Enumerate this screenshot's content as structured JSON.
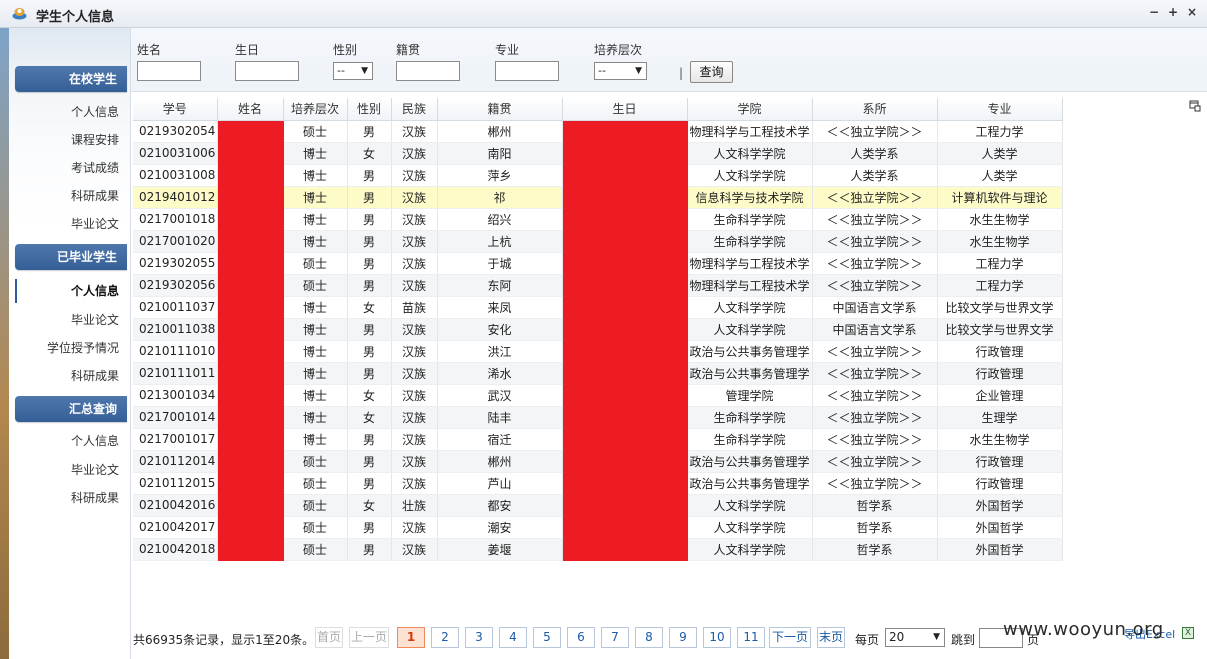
{
  "window": {
    "title": "学生个人信息",
    "controls": [
      "−",
      "+",
      "×"
    ]
  },
  "sidebar": {
    "sections": [
      {
        "header": "在校学生",
        "items": [
          {
            "label": "个人信息"
          },
          {
            "label": "课程安排"
          },
          {
            "label": "考试成绩"
          },
          {
            "label": "科研成果"
          },
          {
            "label": "毕业论文"
          }
        ]
      },
      {
        "header": "已毕业学生",
        "items": [
          {
            "label": "个人信息",
            "active": true
          },
          {
            "label": "毕业论文"
          },
          {
            "label": "学位授予情况"
          },
          {
            "label": "科研成果"
          }
        ]
      },
      {
        "header": "汇总查询",
        "items": [
          {
            "label": "个人信息"
          },
          {
            "label": "毕业论文"
          },
          {
            "label": "科研成果"
          }
        ]
      }
    ]
  },
  "search": {
    "name_label": "姓名",
    "birthday_label": "生日",
    "gender_label": "性别",
    "gender_value": "--",
    "hometown_label": "籍贯",
    "major_label": "专业",
    "level_label": "培养层次",
    "level_value": "--",
    "separator": "|",
    "query_button": "查询"
  },
  "table": {
    "columns": [
      "学号",
      "姓名",
      "培养层次",
      "性别",
      "民族",
      "籍贯",
      "生日",
      "学院",
      "系所",
      "专业"
    ],
    "rows": [
      [
        "0219302054",
        "",
        "硕士",
        "男",
        "汉族",
        "郴州",
        "",
        "物理科学与工程技术学",
        "＜＜独立学院＞＞",
        "工程力学"
      ],
      [
        "0210031006",
        "",
        "博士",
        "女",
        "汉族",
        "南阳",
        "",
        "人文科学学院",
        "人类学系",
        "人类学"
      ],
      [
        "0210031008",
        "",
        "博士",
        "男",
        "汉族",
        "萍乡",
        "",
        "人文科学学院",
        "人类学系",
        "人类学"
      ],
      [
        "0219401012",
        "",
        "博士",
        "男",
        "汉族",
        "祁",
        "",
        "信息科学与技术学院",
        "＜＜独立学院＞＞",
        "计算机软件与理论"
      ],
      [
        "0217001018",
        "",
        "博士",
        "男",
        "汉族",
        "绍兴",
        "",
        "生命科学学院",
        "＜＜独立学院＞＞",
        "水生生物学"
      ],
      [
        "0217001020",
        "",
        "博士",
        "男",
        "汉族",
        "上杭",
        "",
        "生命科学学院",
        "＜＜独立学院＞＞",
        "水生生物学"
      ],
      [
        "0219302055",
        "",
        "硕士",
        "男",
        "汉族",
        "于城",
        "",
        "物理科学与工程技术学",
        "＜＜独立学院＞＞",
        "工程力学"
      ],
      [
        "0219302056",
        "",
        "硕士",
        "男",
        "汉族",
        "东阿",
        "",
        "物理科学与工程技术学",
        "＜＜独立学院＞＞",
        "工程力学"
      ],
      [
        "0210011037",
        "",
        "博士",
        "女",
        "苗族",
        "来凤",
        "",
        "人文科学学院",
        "中国语言文学系",
        "比较文学与世界文学"
      ],
      [
        "0210011038",
        "",
        "博士",
        "男",
        "汉族",
        "安化",
        "",
        "人文科学学院",
        "中国语言文学系",
        "比较文学与世界文学"
      ],
      [
        "0210111010",
        "",
        "博士",
        "男",
        "汉族",
        "洪江",
        "",
        "政治与公共事务管理学",
        "＜＜独立学院＞＞",
        "行政管理"
      ],
      [
        "0210111011",
        "",
        "博士",
        "男",
        "汉族",
        "浠水",
        "",
        "政治与公共事务管理学",
        "＜＜独立学院＞＞",
        "行政管理"
      ],
      [
        "0213001034",
        "",
        "博士",
        "女",
        "汉族",
        "武汉",
        "",
        "管理学院",
        "＜＜独立学院＞＞",
        "企业管理"
      ],
      [
        "0217001014",
        "",
        "博士",
        "女",
        "汉族",
        "陆丰",
        "",
        "生命科学学院",
        "＜＜独立学院＞＞",
        "生理学"
      ],
      [
        "0217001017",
        "",
        "博士",
        "男",
        "汉族",
        "宿迁",
        "",
        "生命科学学院",
        "＜＜独立学院＞＞",
        "水生生物学"
      ],
      [
        "0210112014",
        "",
        "硕士",
        "男",
        "汉族",
        "郴州",
        "",
        "政治与公共事务管理学",
        "＜＜独立学院＞＞",
        "行政管理"
      ],
      [
        "0210112015",
        "",
        "硕士",
        "男",
        "汉族",
        "芦山",
        "",
        "政治与公共事务管理学",
        "＜＜独立学院＞＞",
        "行政管理"
      ],
      [
        "0210042016",
        "",
        "硕士",
        "女",
        "壮族",
        "都安",
        "",
        "人文科学学院",
        "哲学系",
        "外国哲学"
      ],
      [
        "0210042017",
        "",
        "硕士",
        "男",
        "汉族",
        "潮安",
        "",
        "人文科学学院",
        "哲学系",
        "外国哲学"
      ],
      [
        "0210042018",
        "",
        "硕士",
        "男",
        "汉族",
        "姜堰",
        "",
        "人文科学学院",
        "哲学系",
        "外国哲学"
      ]
    ],
    "highlight_row": 3,
    "redact_color": "#ed1c24"
  },
  "pager": {
    "info": "共66935条记录，显示1至20条。",
    "first": "首页",
    "prev": "上一页",
    "pages": [
      "1",
      "2",
      "3",
      "4",
      "5",
      "6",
      "7",
      "8",
      "9",
      "10",
      "11"
    ],
    "current": "1",
    "next": "下一页",
    "last": "末页",
    "per_page_label": "每页",
    "per_page_value": "20",
    "jump_label": "跳到",
    "page_suffix": "页",
    "export": "导出Excel"
  },
  "watermark": "www.wooyun.org"
}
